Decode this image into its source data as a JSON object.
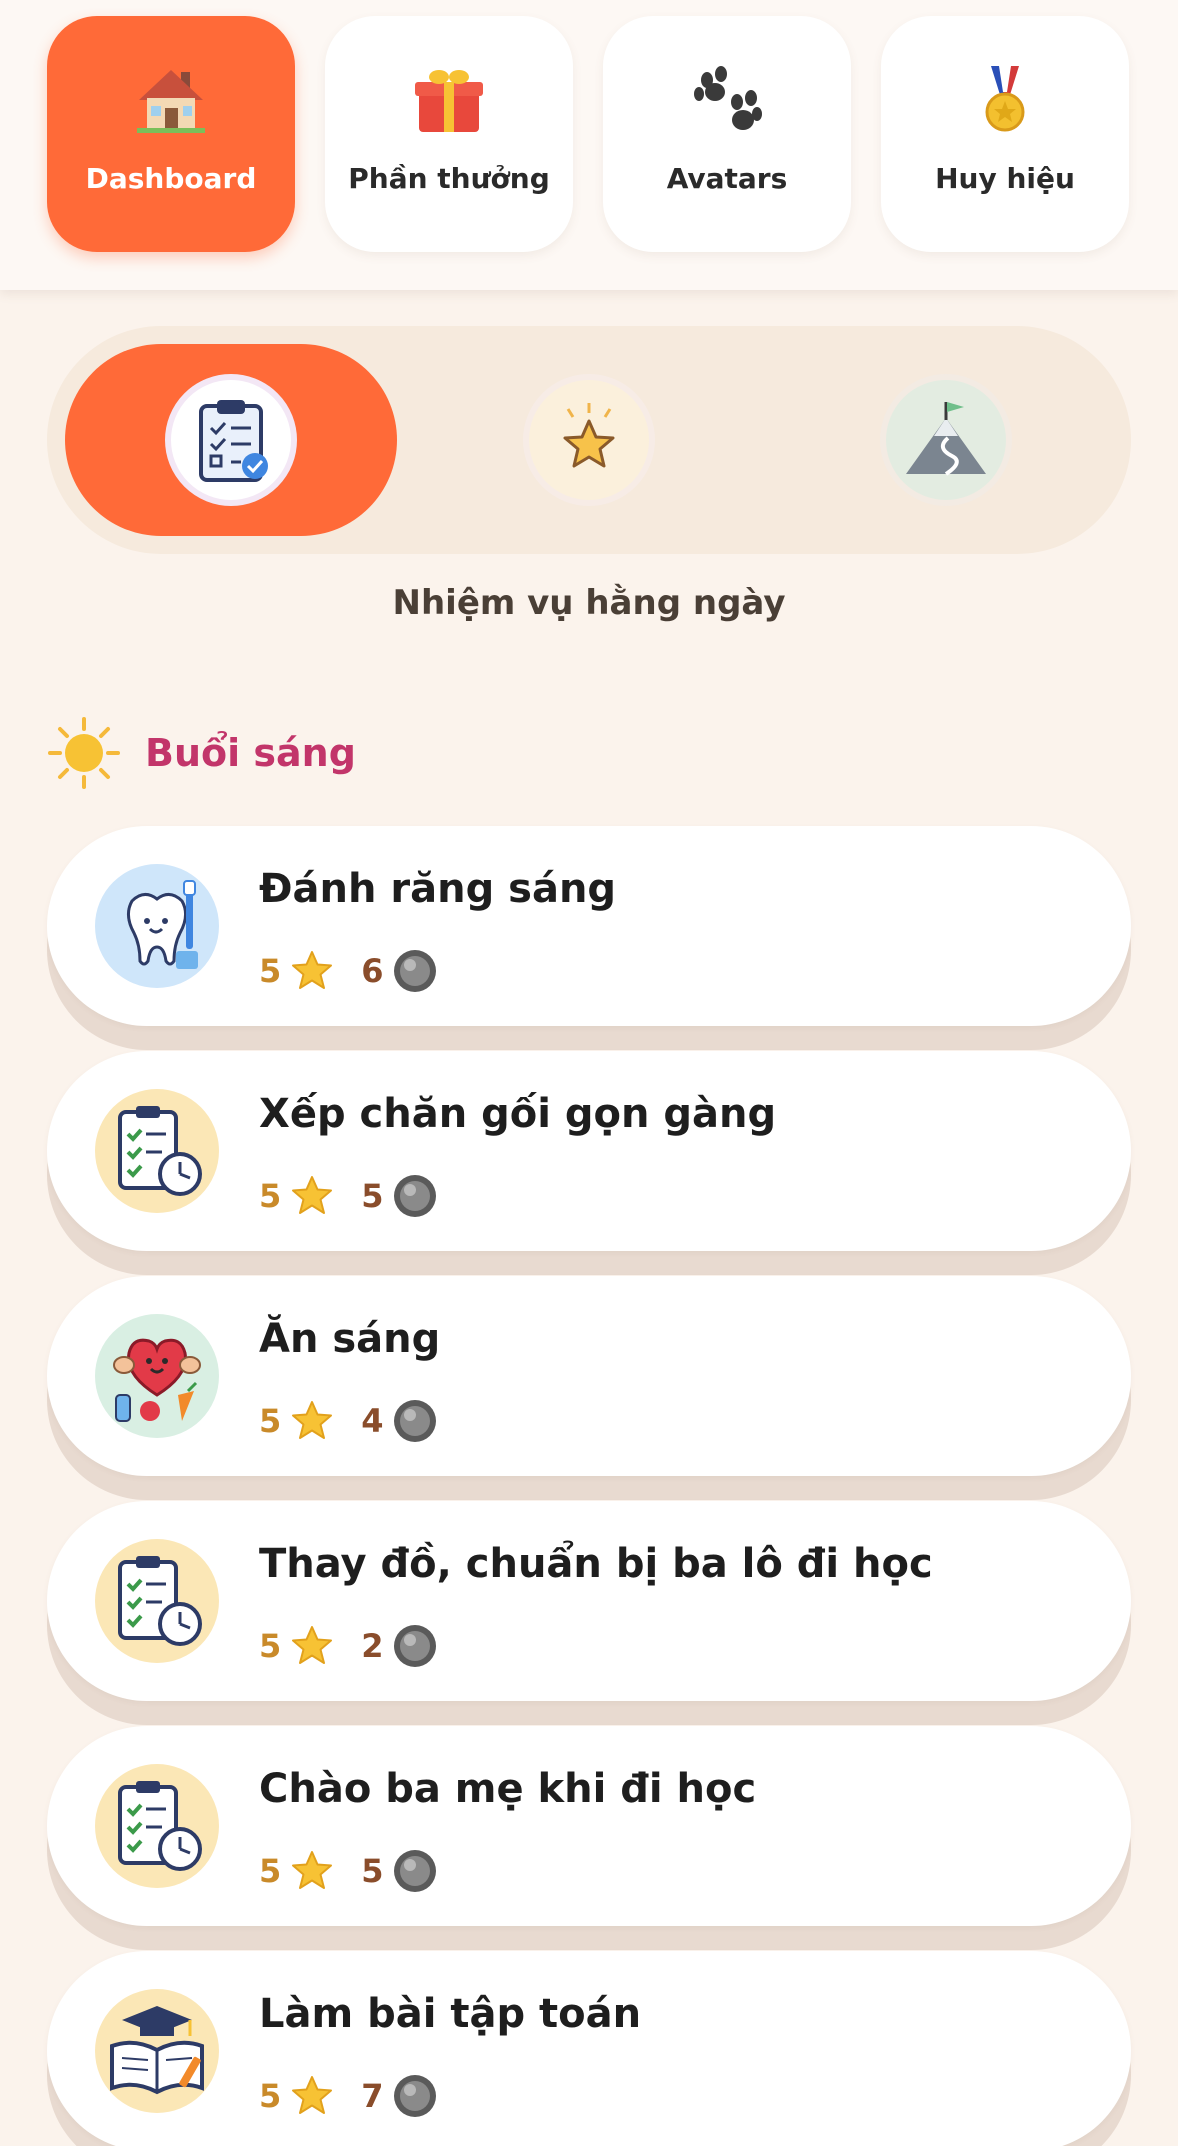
{
  "nav": {
    "items": [
      {
        "label": "Dashboard",
        "icon": "house-icon",
        "active": true
      },
      {
        "label": "Phần thưởng",
        "icon": "gift-icon",
        "active": false
      },
      {
        "label": "Avatars",
        "icon": "paw-icon",
        "active": false
      },
      {
        "label": "Huy hiệu",
        "icon": "medal-icon",
        "active": false
      }
    ],
    "active_color": "#ff6a38"
  },
  "segments": {
    "items": [
      {
        "icon": "clipboard-checklist-icon",
        "active": true
      },
      {
        "icon": "star-icon",
        "active": false
      },
      {
        "icon": "mountain-flag-icon",
        "active": false
      }
    ],
    "title": "Nhiệm vụ hằng ngày"
  },
  "section": {
    "icon": "sun-icon",
    "title": "Buổi sáng",
    "title_color": "#c2356a"
  },
  "tasks": [
    {
      "title": "Đánh răng sáng",
      "stars": "5",
      "coins": "6",
      "icon": "tooth-brush-icon"
    },
    {
      "title": "Xếp chăn gối gọn gàng",
      "stars": "5",
      "coins": "5",
      "icon": "clipboard-clock-icon"
    },
    {
      "title": "Ăn sáng",
      "stars": "5",
      "coins": "4",
      "icon": "heart-food-icon"
    },
    {
      "title": "Thay đồ, chuẩn bị ba lô đi học",
      "stars": "5",
      "coins": "2",
      "icon": "clipboard-clock-icon"
    },
    {
      "title": "Chào ba mẹ khi đi học",
      "stars": "5",
      "coins": "5",
      "icon": "clipboard-clock-icon"
    },
    {
      "title": "Làm bài tập toán",
      "stars": "5",
      "coins": "7",
      "icon": "book-graduation-icon"
    }
  ]
}
